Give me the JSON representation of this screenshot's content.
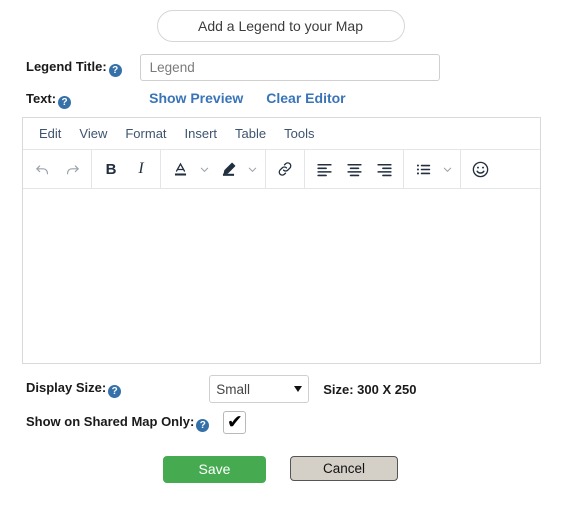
{
  "header": {
    "add_legend_label": "Add a Legend to your Map"
  },
  "legend_title": {
    "label": "Legend Title:",
    "help_glyph": "?",
    "value": "Legend",
    "placeholder": "Legend"
  },
  "text_section": {
    "label": "Text:",
    "help_glyph": "?",
    "show_preview_label": "Show Preview",
    "clear_editor_label": "Clear Editor"
  },
  "editor": {
    "menu": [
      {
        "label": "Edit",
        "name": "menu-edit"
      },
      {
        "label": "View",
        "name": "menu-view"
      },
      {
        "label": "Format",
        "name": "menu-format"
      },
      {
        "label": "Insert",
        "name": "menu-insert"
      },
      {
        "label": "Table",
        "name": "menu-table"
      },
      {
        "label": "Tools",
        "name": "menu-tools"
      }
    ],
    "toolbar": [
      {
        "icon": "undo-icon",
        "state": "disabled"
      },
      {
        "icon": "redo-icon",
        "state": "disabled"
      },
      {
        "icon": "bold-icon",
        "glyph": "B",
        "state": "enabled"
      },
      {
        "icon": "italic-icon",
        "glyph": "I",
        "state": "enabled"
      },
      {
        "icon": "text-color-icon",
        "glyph": "A",
        "state": "enabled"
      },
      {
        "icon": "chevron-down-icon",
        "state": "enabled"
      },
      {
        "icon": "highlight-color-icon",
        "state": "enabled"
      },
      {
        "icon": "chevron-down-icon",
        "state": "enabled"
      },
      {
        "icon": "link-icon",
        "state": "enabled"
      },
      {
        "icon": "align-left-icon",
        "state": "enabled"
      },
      {
        "icon": "align-center-icon",
        "state": "enabled"
      },
      {
        "icon": "align-right-icon",
        "state": "enabled"
      },
      {
        "icon": "bullet-list-icon",
        "state": "enabled"
      },
      {
        "icon": "chevron-down-icon",
        "state": "enabled"
      },
      {
        "icon": "emoji-icon",
        "state": "enabled"
      }
    ],
    "body_text": ""
  },
  "display_size": {
    "label": "Display Size:",
    "help_glyph": "?",
    "selected": "Small",
    "options": [
      "Small"
    ],
    "size_note": "Size: 300 X 250"
  },
  "shared_map": {
    "label": "Show on Shared Map Only:",
    "help_glyph": "?",
    "checked": true,
    "check_glyph": "✔"
  },
  "footer": {
    "save_label": "Save",
    "cancel_label": "Cancel"
  },
  "colors": {
    "save_green": "#46ab50",
    "link_blue": "#3a74b8",
    "help_blue": "#3571a8",
    "menu_text": "#3d546f",
    "toolbar_icon": "#222f3e",
    "disabled_icon": "#9aa3ab",
    "cancel_gray": "#d4d0c8"
  }
}
